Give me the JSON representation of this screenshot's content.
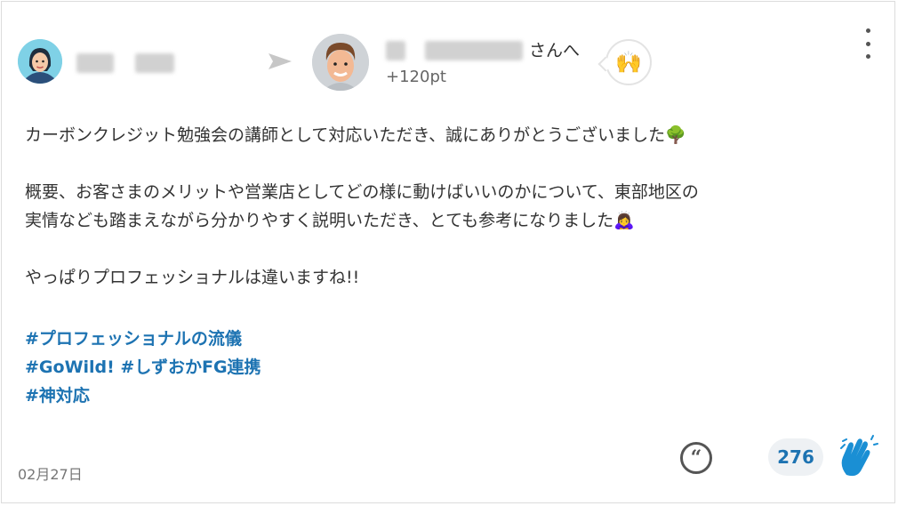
{
  "post": {
    "recipient_suffix": "さんへ",
    "points": "+120pt",
    "stamp_icon": "raising-hands-icon",
    "body_lines": [
      "カーボンクレジット勉強会の講師として対応いただき、誠にありがとうございました🌳",
      "",
      "概要、お客さまのメリットや営業店としてどの様に動けばいいのかについて、東部地区の",
      "実情なども踏まえながら分かりやすく説明いただき、とても参考になりました🙇‍♀️",
      "",
      "やっぱりプロフェッショナルは違いますね!!"
    ],
    "hashtags": [
      "#プロフェッショナルの流儀",
      "#GoWild! #しずおかFG連携",
      "#神対応"
    ],
    "date": "02月27日",
    "clap_count": "276"
  },
  "colors": {
    "hashtag": "#1d73b2",
    "clap": "#1a8fd4",
    "count_bg": "#eef1f4"
  }
}
